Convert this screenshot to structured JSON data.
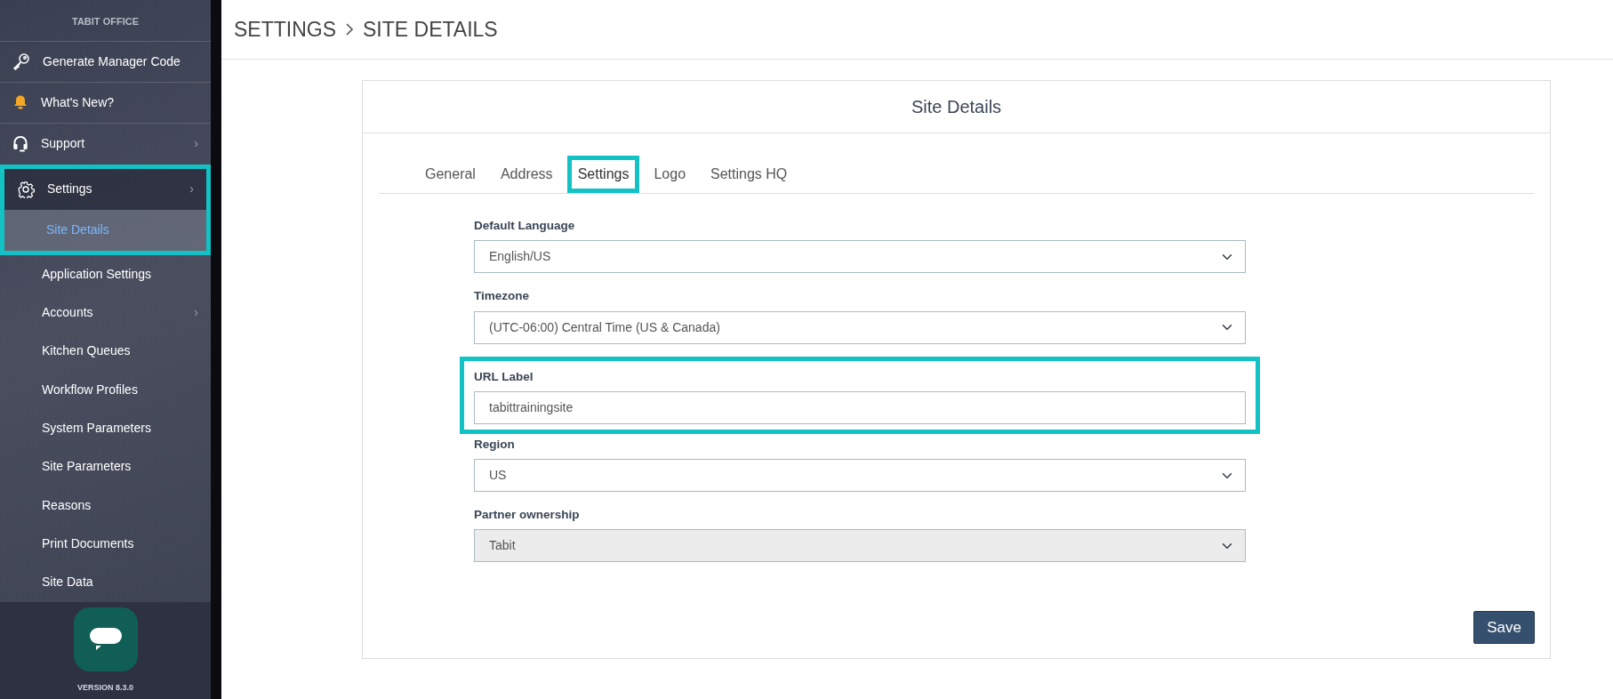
{
  "sidebar": {
    "title": "TABIT OFFICE",
    "items": [
      {
        "label": "Generate Manager Code",
        "highlighted": false,
        "expanded": false
      },
      {
        "label": "What's New?",
        "highlighted": false,
        "expanded": false
      },
      {
        "label": "Support",
        "chevron": "›",
        "highlighted": false,
        "expanded": false
      },
      {
        "label": "Settings",
        "chevron": "›",
        "highlighted": true,
        "expanded": true,
        "children": [
          {
            "label": "Site Details",
            "selected": true,
            "highlighted": true
          },
          {
            "label": "Application Settings",
            "selected": false,
            "highlighted": false
          },
          {
            "label": "Accounts",
            "chevron": "›",
            "selected": false,
            "highlighted": false
          },
          {
            "label": "Kitchen Queues",
            "selected": false,
            "highlighted": false
          },
          {
            "label": "Workflow Profiles",
            "selected": false,
            "highlighted": false
          },
          {
            "label": "System Parameters",
            "selected": false,
            "highlighted": false
          },
          {
            "label": "Site Parameters",
            "selected": false,
            "highlighted": false
          },
          {
            "label": "Reasons",
            "selected": false,
            "highlighted": false
          },
          {
            "label": "Print Documents",
            "selected": false,
            "highlighted": false
          },
          {
            "label": "Site Data",
            "selected": false,
            "highlighted": false
          }
        ]
      }
    ],
    "version": "VERSION 8.3.0"
  },
  "breadcrumb": [
    "SETTINGS",
    "SITE DETAILS"
  ],
  "card": {
    "title": "Site Details",
    "tabs": [
      {
        "label": "General",
        "selected": false,
        "highlighted": false
      },
      {
        "label": "Address",
        "selected": false,
        "highlighted": false
      },
      {
        "label": "Settings",
        "selected": true,
        "highlighted": true
      },
      {
        "label": "Logo",
        "selected": false,
        "highlighted": false
      },
      {
        "label": "Settings HQ",
        "selected": false,
        "highlighted": false
      }
    ],
    "fields": [
      {
        "kind": "select",
        "label": "Default Language",
        "value": "English/US",
        "disabled": false,
        "highlighted": false
      },
      {
        "kind": "select",
        "label": "Timezone",
        "value": "(UTC-06:00) Central Time (US & Canada)",
        "disabled": false,
        "highlighted": false
      },
      {
        "kind": "text",
        "label": "URL Label",
        "value": "tabittrainingsite",
        "disabled": false,
        "highlighted": true
      },
      {
        "kind": "select",
        "label": "Region",
        "value": "US",
        "disabled": false,
        "highlighted": false
      },
      {
        "kind": "select",
        "label": "Partner ownership",
        "value": "Tabit",
        "disabled": true,
        "highlighted": false
      }
    ],
    "save_button": "Save"
  }
}
